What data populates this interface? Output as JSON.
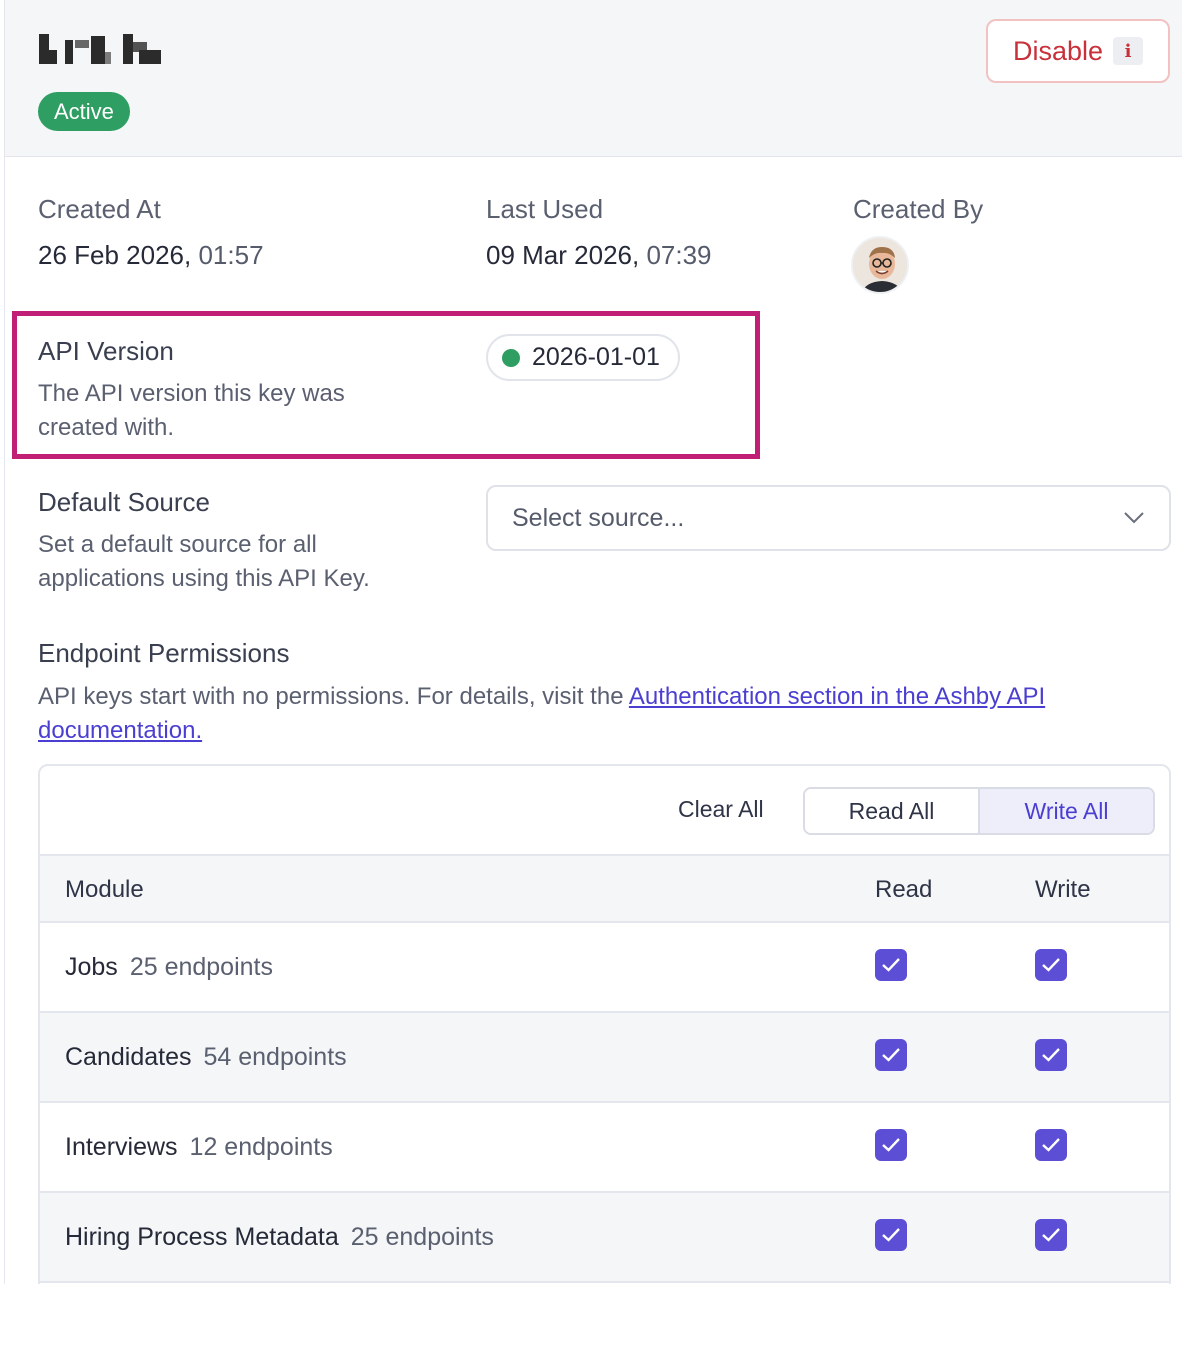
{
  "header": {
    "status_badge": "Active",
    "disable_label": "Disable",
    "disable_shortcut": "i"
  },
  "meta": {
    "created_at_label": "Created At",
    "created_at_date": "26 Feb 2026,",
    "created_at_time": "01:57",
    "last_used_label": "Last Used",
    "last_used_date": "09 Mar 2026,",
    "last_used_time": "07:39",
    "created_by_label": "Created By"
  },
  "api_version": {
    "title": "API Version",
    "description": "The API version this key was created with.",
    "value": "2026-01-01",
    "status_color": "#2e9e62"
  },
  "default_source": {
    "title": "Default Source",
    "description": "Set a default source for all applications using this API Key.",
    "placeholder": "Select source..."
  },
  "endpoint_permissions": {
    "title": "Endpoint Permissions",
    "description_prefix": "API keys start with no permissions. For details, visit the ",
    "link_text": "Authentication section in the Ashby API documentation."
  },
  "permissions_table": {
    "clear_all": "Clear All",
    "read_all": "Read All",
    "write_all": "Write All",
    "columns": {
      "module": "Module",
      "read": "Read",
      "write": "Write"
    },
    "rows": [
      {
        "module": "Jobs",
        "count": "25 endpoints",
        "read": true,
        "write": true
      },
      {
        "module": "Candidates",
        "count": "54 endpoints",
        "read": true,
        "write": true
      },
      {
        "module": "Interviews",
        "count": "12 endpoints",
        "read": true,
        "write": true
      },
      {
        "module": "Hiring Process Metadata",
        "count": "25 endpoints",
        "read": true,
        "write": true
      }
    ]
  },
  "colors": {
    "accent": "#5c4fd6",
    "active_green": "#2e9e62",
    "danger": "#c8303a",
    "highlight": "#c01f75"
  }
}
